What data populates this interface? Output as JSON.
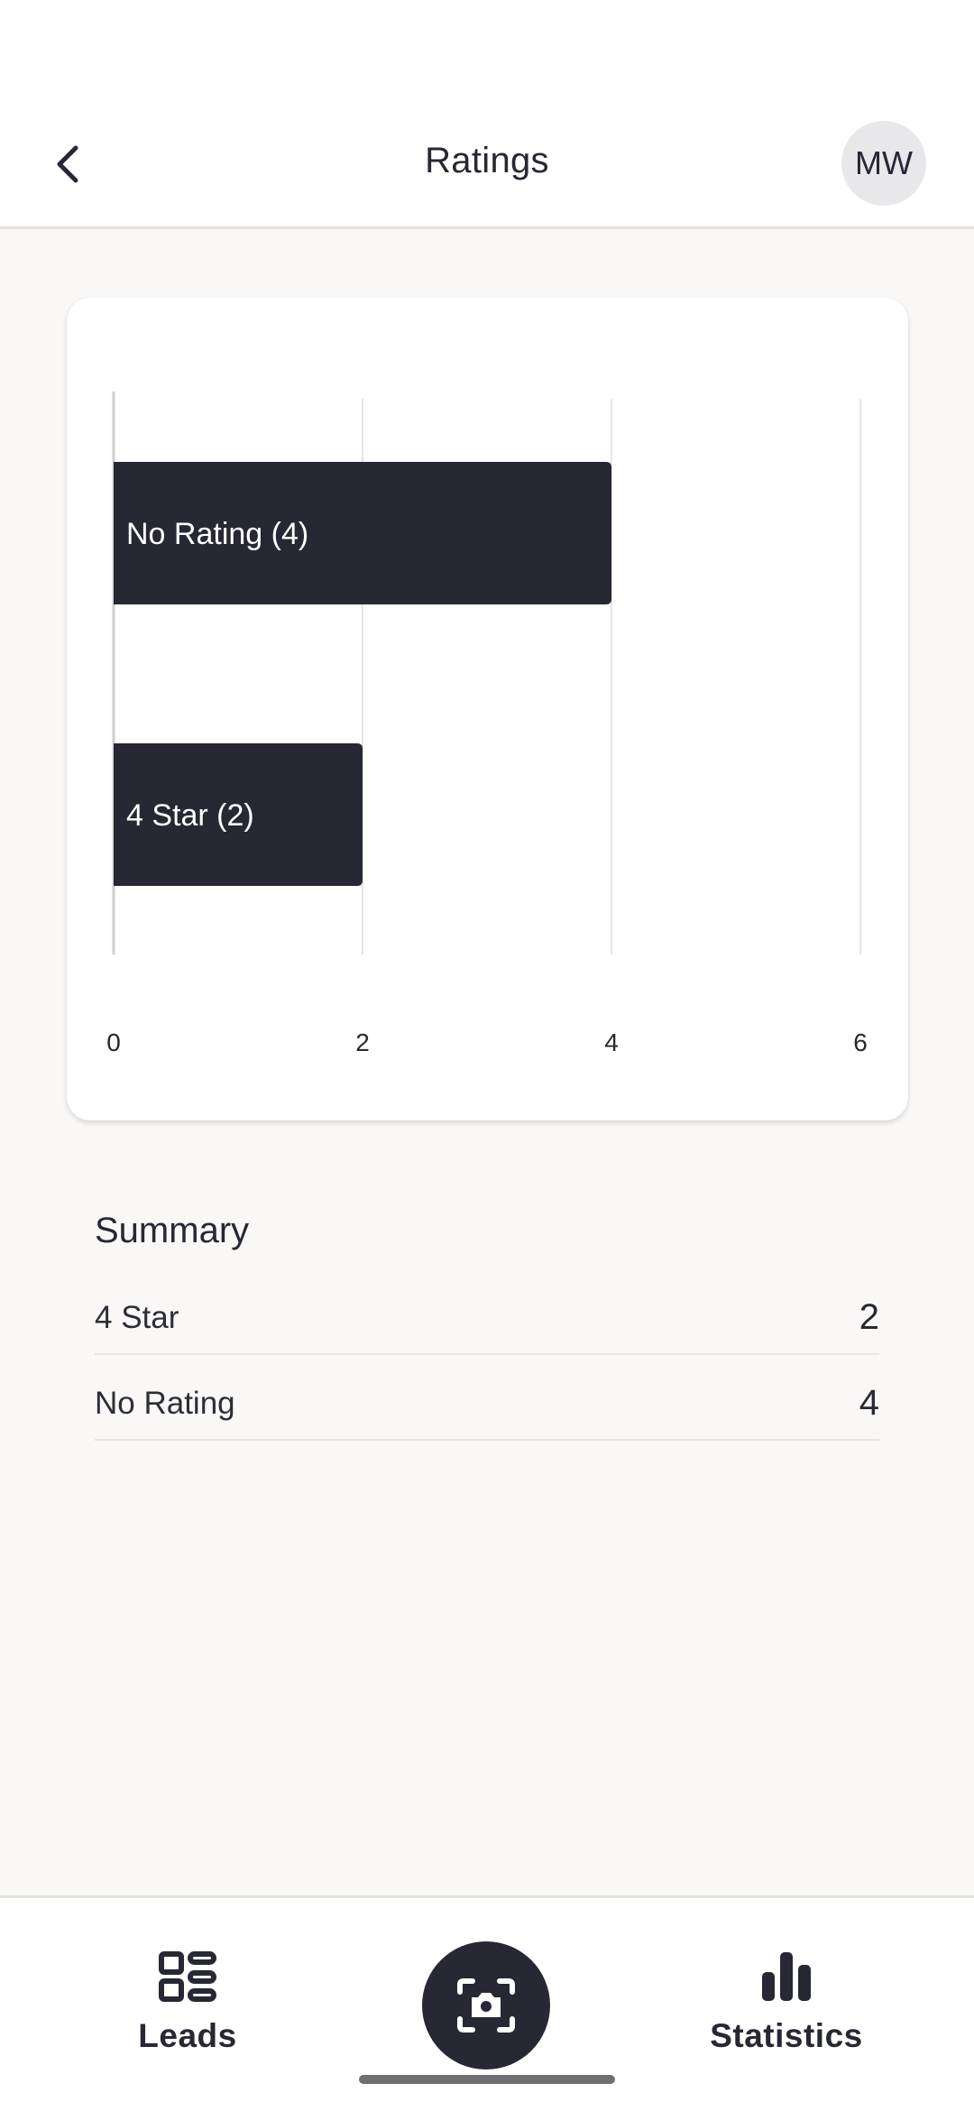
{
  "header": {
    "title": "Ratings",
    "avatar_initials": "MW",
    "back_icon": "chevron-left-icon"
  },
  "chart_data": {
    "type": "bar",
    "orientation": "horizontal",
    "categories": [
      "No Rating (4)",
      "4 Star (2)"
    ],
    "values": [
      4,
      2
    ],
    "xlim": [
      0,
      6
    ],
    "x_ticks": [
      "0",
      "2",
      "4",
      "6"
    ],
    "grid": true,
    "bar_color": "#272834",
    "label_color": "#ffffff"
  },
  "summary": {
    "title": "Summary",
    "rows": [
      {
        "label": "4 Star",
        "value": "2"
      },
      {
        "label": "No Rating",
        "value": "4"
      }
    ]
  },
  "bottom_nav": {
    "leads_label": "Leads",
    "leads_icon": "dashboard-icon",
    "camera_icon": "camera-scan-icon",
    "statistics_label": "Statistics",
    "statistics_icon": "bar-chart-icon"
  },
  "colors": {
    "primary": "#272834",
    "background": "#f9f8f6",
    "surface": "#ffffff",
    "divider": "#e2e1dc"
  }
}
